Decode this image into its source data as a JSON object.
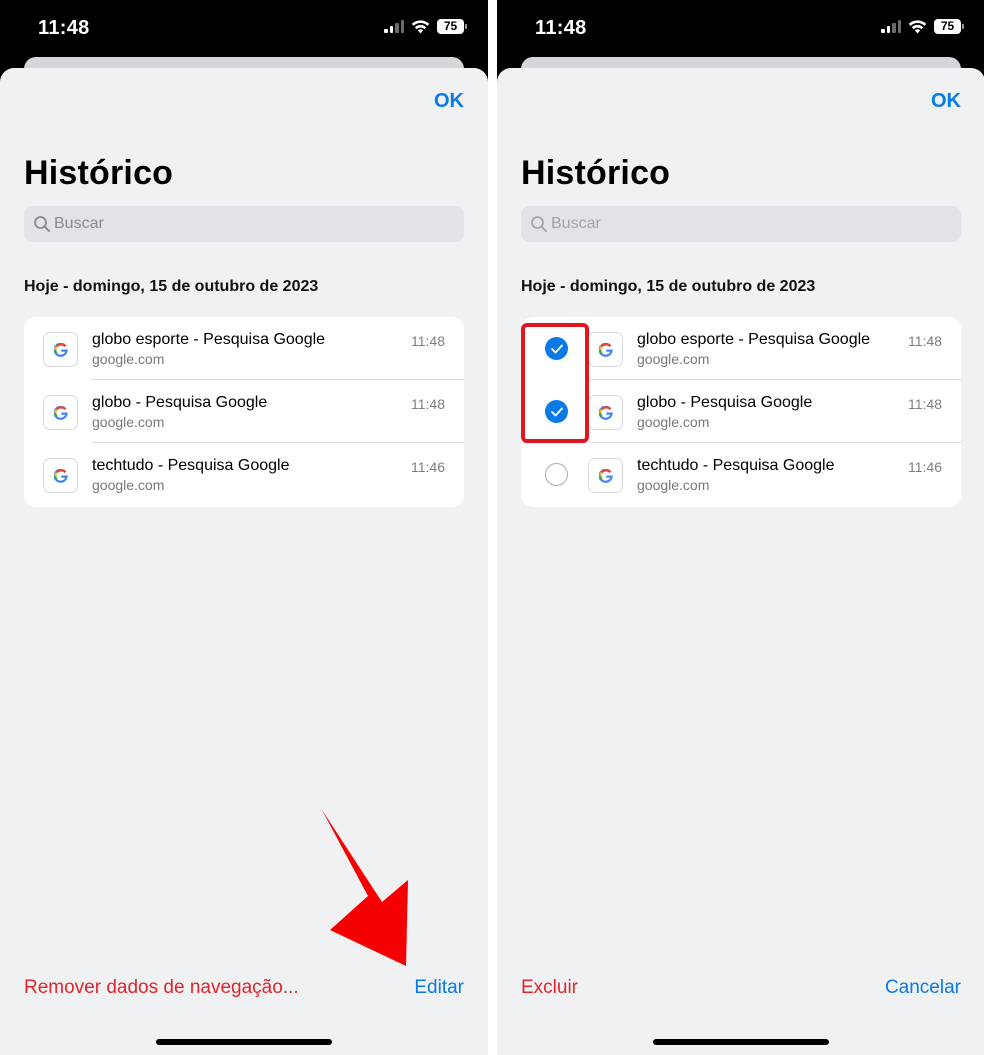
{
  "colors": {
    "accent": "#0a7ae6",
    "destructive": "#e0262c",
    "highlight": "#e3161e",
    "arrow": "#f40000"
  },
  "status_bar": {
    "time": "11:48",
    "battery": "75"
  },
  "left_screen": {
    "done_label": "OK",
    "title": "Histórico",
    "search": {
      "placeholder": "Buscar"
    },
    "section_header": "Hoje - domingo, 15 de outubro de 2023",
    "items": [
      {
        "title": "globo esporte - Pesquisa Google",
        "url": "google.com",
        "time": "11:48",
        "icon": "google-g-icon"
      },
      {
        "title": "globo - Pesquisa Google",
        "url": "google.com",
        "time": "11:48",
        "icon": "google-g-icon"
      },
      {
        "title": "techtudo - Pesquisa Google",
        "url": "google.com",
        "time": "11:46",
        "icon": "google-g-icon"
      }
    ],
    "footer": {
      "clear_label": "Remover dados de navegação...",
      "edit_label": "Editar"
    },
    "annotation": "red-arrow-pointing-to-edit"
  },
  "right_screen": {
    "done_label": "OK",
    "title": "Histórico",
    "search": {
      "placeholder": "Buscar"
    },
    "section_header": "Hoje - domingo, 15 de outubro de 2023",
    "items": [
      {
        "title": "globo esporte - Pesquisa Google",
        "url": "google.com",
        "time": "11:48",
        "selected": true,
        "icon": "google-g-icon"
      },
      {
        "title": "globo - Pesquisa Google",
        "url": "google.com",
        "time": "11:48",
        "selected": true,
        "icon": "google-g-icon"
      },
      {
        "title": "techtudo - Pesquisa Google",
        "url": "google.com",
        "time": "11:46",
        "selected": false,
        "icon": "google-g-icon"
      }
    ],
    "footer": {
      "delete_label": "Excluir",
      "cancel_label": "Cancelar"
    },
    "annotation": "red-box-around-selected-checkboxes"
  }
}
